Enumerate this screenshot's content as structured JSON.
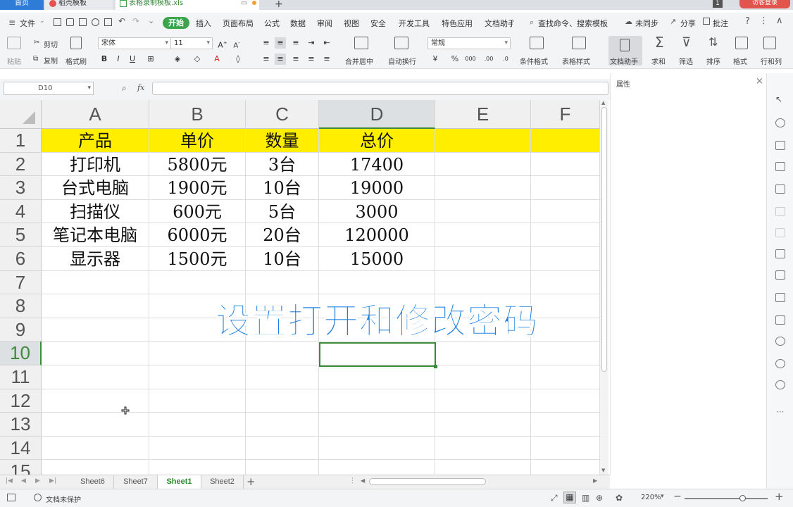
{
  "title_tabs": {
    "home": "首页",
    "wps_template": "稻壳模板",
    "file": "表格录制模板.xls",
    "login": "访客登录",
    "page_count": "1"
  },
  "menu": {
    "file": "文件",
    "start": "开始",
    "items": [
      "插入",
      "页面布局",
      "公式",
      "数据",
      "审阅",
      "视图",
      "安全",
      "开发工具",
      "特色应用",
      "文档助手"
    ],
    "search": "查找命令、搜索模板",
    "unsynced": "未同步",
    "share": "分享",
    "comment": "批注"
  },
  "ribbon": {
    "paste": "粘贴",
    "cut": "剪切",
    "copy": "复制",
    "format_painter": "格式刷",
    "font_name": "宋体",
    "font_size": "11",
    "merge_center": "合并居中",
    "wrap_text": "自动换行",
    "number_format": "常规",
    "conditional_format": "条件格式",
    "table_style": "表格样式",
    "doc_helper": "文档助手",
    "sum": "求和",
    "filter": "筛选",
    "sort": "排序",
    "format": "格式",
    "row_col": "行和列"
  },
  "formula_bar": {
    "cell_ref": "D10",
    "fx": "fx",
    "content": ""
  },
  "properties_panel": {
    "title": "属性"
  },
  "sheet": {
    "columns": [
      "A",
      "B",
      "C",
      "D",
      "E",
      "F"
    ],
    "active_column": "D",
    "active_row": 10,
    "row_numbers": [
      1,
      2,
      3,
      4,
      5,
      6,
      7,
      8,
      9,
      10,
      11,
      12,
      13,
      14,
      15
    ],
    "header": [
      "产品",
      "单价",
      "数量",
      "总价"
    ],
    "rows": [
      [
        "打印机",
        "5800元",
        "3台",
        "17400"
      ],
      [
        "台式电脑",
        "1900元",
        "10台",
        "19000"
      ],
      [
        "扫描仪",
        "600元",
        "5台",
        "3000"
      ],
      [
        "笔记本电脑",
        "6000元",
        "20台",
        "120000"
      ],
      [
        "显示器",
        "1500元",
        "10台",
        "15000"
      ]
    ],
    "header_fill": "#ffee00",
    "overlay_caption": "设置打开和修改密码",
    "overlay_color": "#1d7fe0"
  },
  "sheet_tabs": {
    "tabs": [
      "Sheet6",
      "Sheet7",
      "Sheet1",
      "Sheet2"
    ],
    "active": "Sheet1",
    "add": "+"
  },
  "status_bar": {
    "protection": "文档未保护",
    "zoom": "220%",
    "zoom_level": 0.7
  },
  "colors": {
    "accent_green": "#3a8a3a",
    "start_button": "#3aa54b",
    "home_tab": "#2f7cd6",
    "login": "#e2554d"
  }
}
